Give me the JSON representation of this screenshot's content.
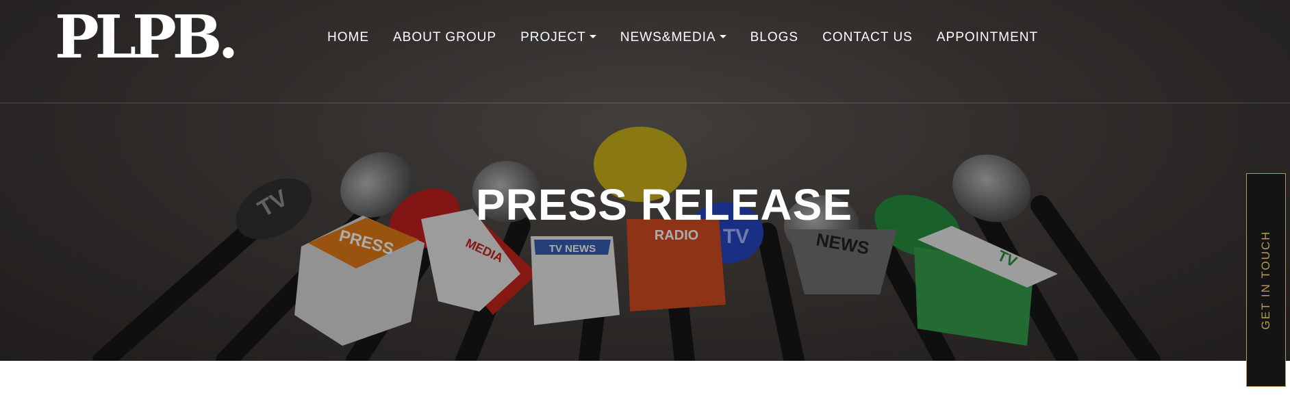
{
  "brand": {
    "logo_text": "PLPB."
  },
  "nav": {
    "items": [
      {
        "label": "HOME",
        "dropdown": false
      },
      {
        "label": "ABOUT GROUP",
        "dropdown": false
      },
      {
        "label": "PROJECT",
        "dropdown": true
      },
      {
        "label": "NEWS&MEDIA",
        "dropdown": true
      },
      {
        "label": "BLOGS",
        "dropdown": false
      },
      {
        "label": "CONTACT US",
        "dropdown": false
      },
      {
        "label": "APPOINTMENT",
        "dropdown": false
      }
    ]
  },
  "hero": {
    "title": "PRESS RELEASE",
    "mic_labels": [
      "TV",
      "PRESS",
      "MEDIA",
      "TV NEWS",
      "RADIO",
      "TV",
      "NEWS",
      "TV"
    ]
  },
  "side_tab": {
    "label": "GET IN TOUCH"
  },
  "colors": {
    "accent": "#b59a55",
    "nav_text": "#ffffff",
    "hero_bg": "#3e3b38"
  }
}
